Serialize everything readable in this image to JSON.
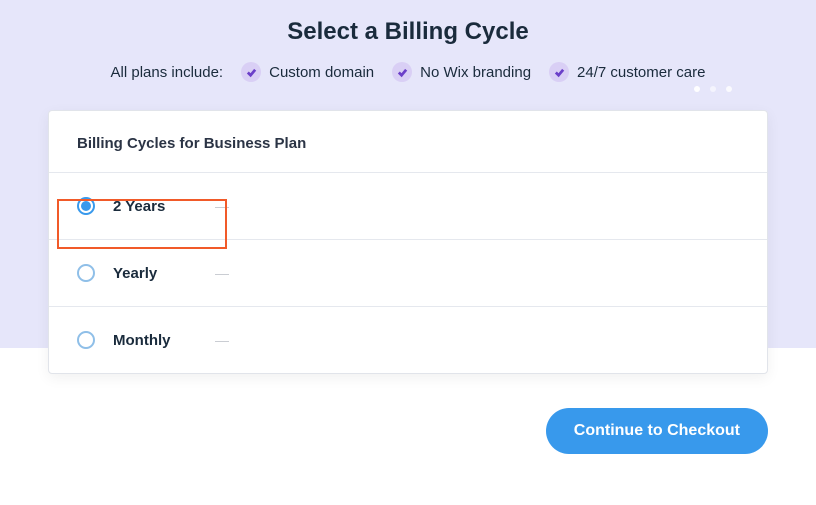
{
  "header": {
    "title": "Select a Billing Cycle",
    "includes_label": "All plans include:",
    "includes": [
      {
        "label": "Custom domain"
      },
      {
        "label": "No Wix branding"
      },
      {
        "label": "24/7 customer care"
      }
    ]
  },
  "card": {
    "title": "Billing Cycles for Business Plan",
    "cycles": [
      {
        "label": "2 Years",
        "selected": true
      },
      {
        "label": "Yearly",
        "selected": false
      },
      {
        "label": "Monthly",
        "selected": false
      }
    ]
  },
  "cta": {
    "label": "Continue to Checkout"
  }
}
